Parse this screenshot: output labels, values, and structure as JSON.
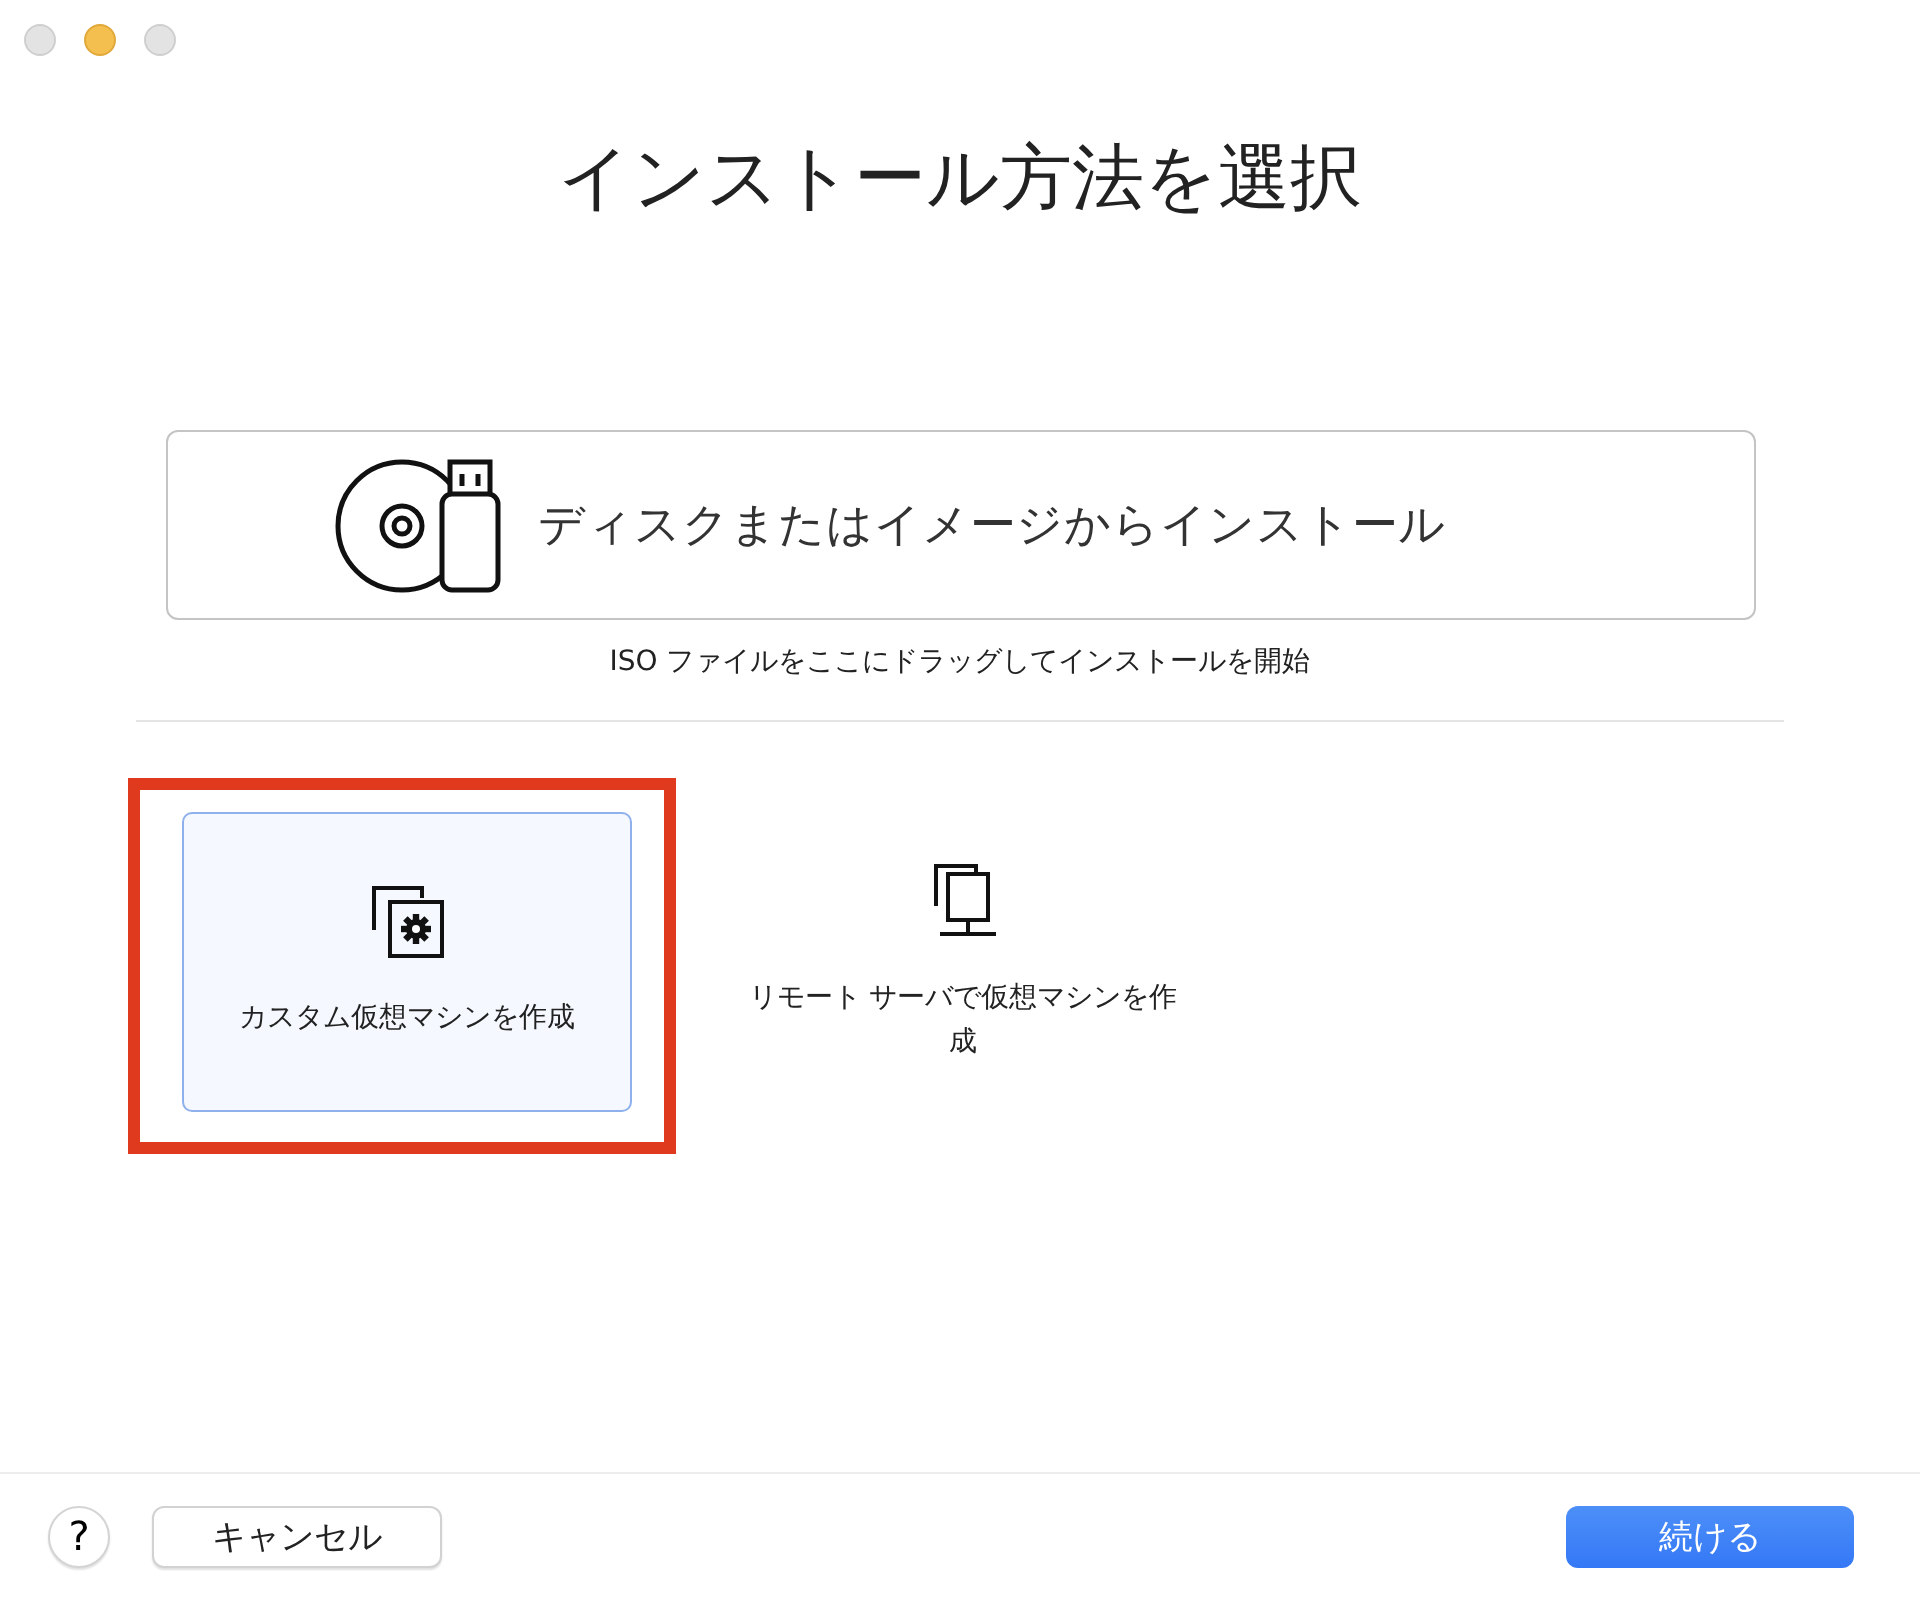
{
  "window_controls": [
    {
      "enabled": false
    },
    {
      "enabled": true
    },
    {
      "enabled": false
    }
  ],
  "title": "インストール方法を選択",
  "disk_option": {
    "label": "ディスクまたはイメージからインストール",
    "hint": "ISO ファイルをここにドラッグしてインストールを開始"
  },
  "options": [
    {
      "kind": "custom",
      "label": "カスタム仮想マシンを作成",
      "selected": true,
      "highlighted": true
    },
    {
      "kind": "remote",
      "label": "リモート サーバで仮想マシンを作成",
      "selected": false,
      "highlighted": false
    }
  ],
  "footer": {
    "help": "?",
    "cancel": "キャンセル",
    "continue": "続ける"
  }
}
